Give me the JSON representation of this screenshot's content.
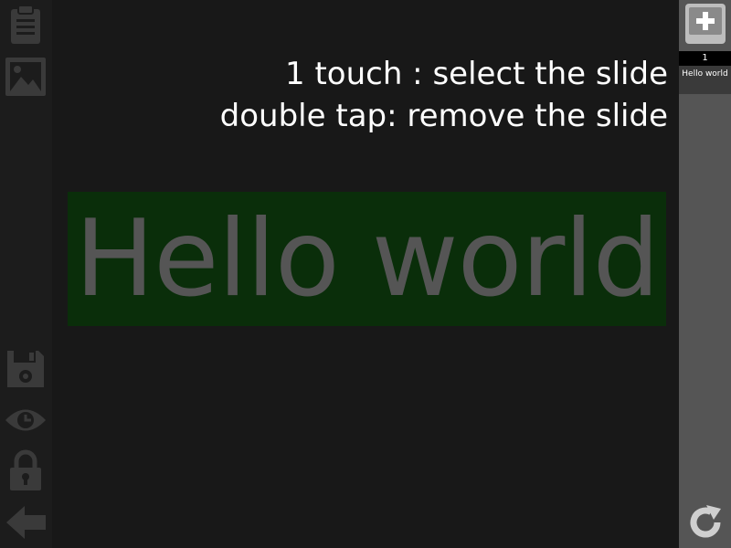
{
  "toolbar": {
    "icons": [
      "clipboard-icon",
      "image-icon",
      "save-icon",
      "preview-icon",
      "lock-icon",
      "back-arrow-icon"
    ],
    "icon_color": "#3a3a3a"
  },
  "canvas": {
    "hint_line1": "1 touch : select the slide",
    "hint_line2": "double tap: remove the slide",
    "text_box": {
      "text": "Hello world",
      "background": "#0a2e0a",
      "text_color": "#555555"
    }
  },
  "slides_panel": {
    "background": "#555555",
    "add_icon": "add-slide-icon",
    "slides": [
      {
        "number": "1",
        "label": "Hello world"
      }
    ],
    "refresh_icon": "refresh-icon"
  }
}
